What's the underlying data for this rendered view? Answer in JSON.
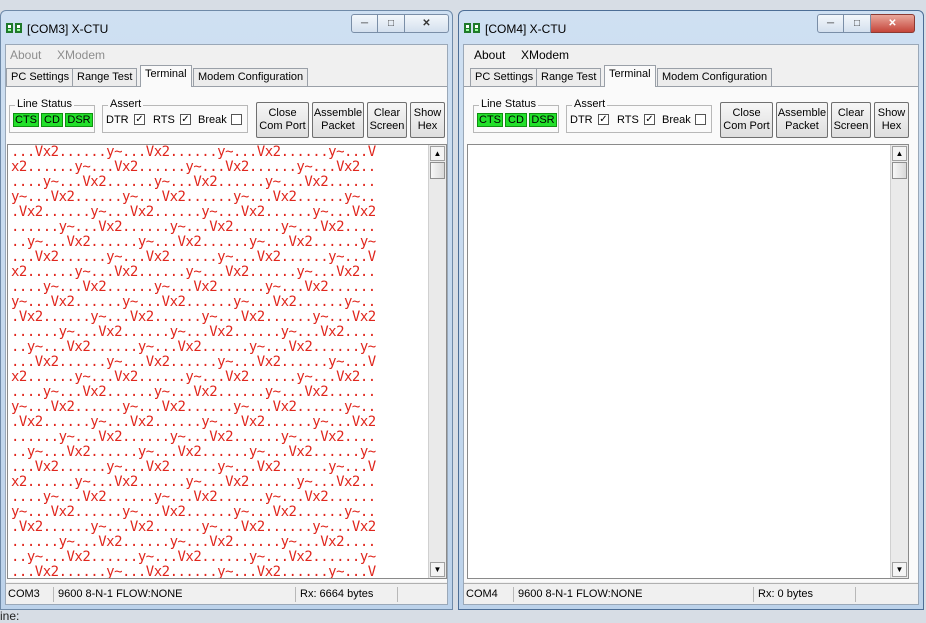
{
  "menu": {
    "about": "About",
    "xmodem": "XModem"
  },
  "tabs": {
    "pc_settings": "PC Settings",
    "range_test": "Range Test",
    "terminal": "Terminal",
    "modem_config": "Modem Configuration"
  },
  "line_status": {
    "label": "Line Status",
    "cts": "CTS",
    "cd": "CD",
    "dsr": "DSR",
    "led_color": "#22e02a"
  },
  "assert": {
    "label": "Assert",
    "dtr": "DTR",
    "rts": "RTS",
    "brk": "Break",
    "check_mark": "✓"
  },
  "buttons": {
    "close_com_port": [
      "Close",
      "Com Port"
    ],
    "assemble_packet": [
      "Assemble",
      "Packet"
    ],
    "clear_screen": [
      "Clear",
      "Screen"
    ],
    "show_hex": [
      "Show",
      "Hex"
    ]
  },
  "window_controls": {
    "minimize": "─",
    "maximize": "□",
    "close": "✕"
  },
  "scroll": {
    "up": "▲",
    "down": "▼"
  },
  "windows": [
    {
      "title": "[COM3] X-CTU",
      "status": {
        "port": "COM3",
        "settings": "9600 8-N-1  FLOW:NONE",
        "rx": "Rx: 6664 bytes"
      },
      "terminal_lines": [
        "...Vx2......y~...Vx2......y~...Vx2......y~...V",
        "x2......y~...Vx2......y~...Vx2......y~...Vx2..",
        "....y~...Vx2......y~...Vx2......y~...Vx2......",
        "y~...Vx2......y~...Vx2......y~...Vx2......y~..",
        ".Vx2......y~...Vx2......y~...Vx2......y~...Vx2",
        "......y~...Vx2......y~...Vx2......y~...Vx2....",
        "..y~...Vx2......y~...Vx2......y~...Vx2......y~",
        "...Vx2......y~...Vx2......y~...Vx2......y~...V",
        "x2......y~...Vx2......y~...Vx2......y~...Vx2..",
        "....y~...Vx2......y~...Vx2......y~...Vx2......",
        "y~...Vx2......y~...Vx2......y~...Vx2......y~..",
        ".Vx2......y~...Vx2......y~...Vx2......y~...Vx2",
        "......y~...Vx2......y~...Vx2......y~...Vx2....",
        "..y~...Vx2......y~...Vx2......y~...Vx2......y~",
        "...Vx2......y~...Vx2......y~...Vx2......y~...V",
        "x2......y~...Vx2......y~...Vx2......y~...Vx2..",
        "....y~...Vx2......y~...Vx2......y~...Vx2......",
        "y~...Vx2......y~...Vx2......y~...Vx2......y~..",
        ".Vx2......y~...Vx2......y~...Vx2......y~...Vx2",
        "......y~...Vx2......y~...Vx2......y~...Vx2....",
        "..y~...Vx2......y~...Vx2......y~...Vx2......y~",
        "...Vx2......y~...Vx2......y~...Vx2......y~...V",
        "x2......y~...Vx2......y~...Vx2......y~...Vx2..",
        "....y~...Vx2......y~...Vx2......y~...Vx2......",
        "y~...Vx2......y~...Vx2......y~...Vx2......y~..",
        ".Vx2......y~...Vx2......y~...Vx2......y~...Vx2",
        "......y~...Vx2......y~...Vx2......y~...Vx2....",
        "..y~...Vx2......y~...Vx2......y~...Vx2......y~",
        "...Vx2......y~...Vx2......y~...Vx2......y~...V",
        "x2......y~...Vx2......y~...Vx2......y~...Vx2.."
      ]
    },
    {
      "title": "[COM4] X-CTU",
      "status": {
        "port": "COM4",
        "settings": "9600 8-N-1  FLOW:NONE",
        "rx": "Rx: 0 bytes"
      },
      "terminal_lines": []
    }
  ],
  "desktop_fragment": "ine:",
  "colors": {
    "terminal_text": "#e0261d",
    "title_bar": "#cfe0f2",
    "close_hover": "#c5453a"
  }
}
